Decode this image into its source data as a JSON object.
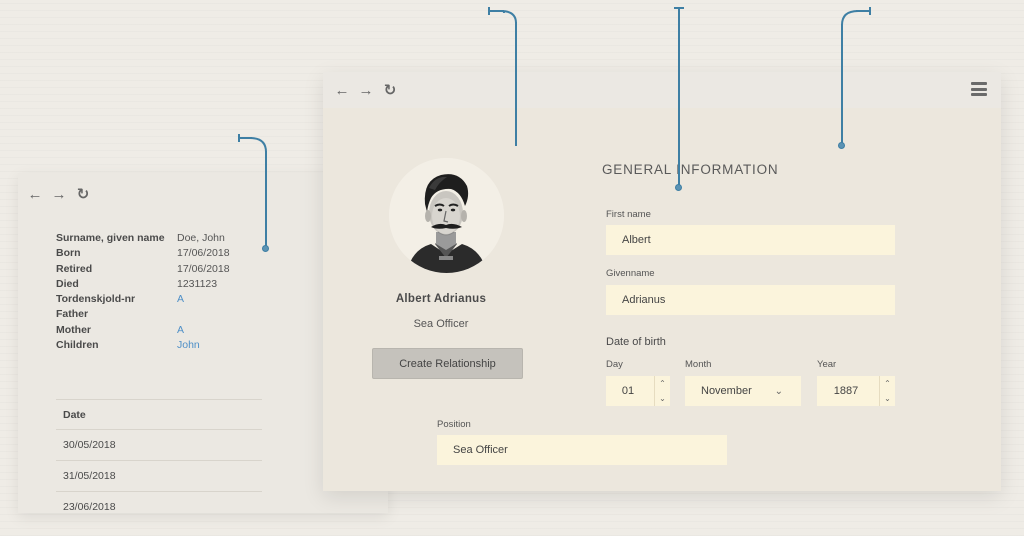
{
  "back_window": {
    "details": [
      {
        "label": "Surname, given name",
        "value": "Doe, John",
        "link": false
      },
      {
        "label": "Born",
        "value": "17/06/2018",
        "link": false
      },
      {
        "label": "Retired",
        "value": "17/06/2018",
        "link": false
      },
      {
        "label": "Died",
        "value": "1231123",
        "link": false
      },
      {
        "label": "Tordenskjold-nr",
        "value": "A",
        "link": true
      },
      {
        "label": "Father",
        "value": "",
        "link": false
      },
      {
        "label": "Mother",
        "value": "A",
        "link": true
      },
      {
        "label": "Children",
        "value": "John",
        "link": true
      }
    ],
    "date_table": {
      "header": "Date",
      "rows": [
        "30/05/2018",
        "31/05/2018",
        "23/06/2018"
      ]
    }
  },
  "front_window": {
    "profile": {
      "name": "Albert Adrianus",
      "title": "Sea Officer",
      "create_button": "Create Relationship"
    },
    "form": {
      "section_title": "GENERAL INFORMATION",
      "first_name_label": "First name",
      "first_name_value": "Albert",
      "givenname_label": "Givenname",
      "givenname_value": "Adrianus",
      "dob_heading": "Date of birth",
      "day_label": "Day",
      "day_value": "01",
      "month_label": "Month",
      "month_value": "November",
      "year_label": "Year",
      "year_value": "1887",
      "position_label": "Position",
      "position_value": "Sea Officer"
    }
  },
  "icons": {
    "back": "arrow-left-icon",
    "forward": "arrow-right-icon",
    "reload": "reload-icon",
    "menu": "hamburger-menu-icon"
  },
  "colors": {
    "accent_line": "#3e7fa4",
    "input_bg": "#fbf4dc",
    "link": "#4e8fc7"
  }
}
